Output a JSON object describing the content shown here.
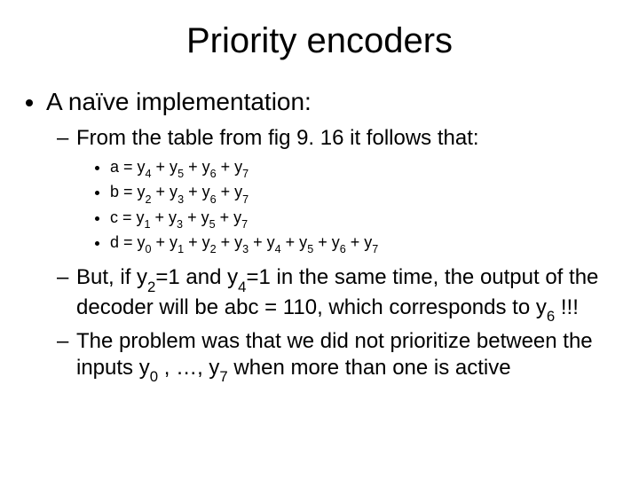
{
  "title": "Priority encoders",
  "l1": "A naïve implementation:",
  "l2a": "From the table from fig 9. 16 it follows that:",
  "eq_a_pre": "a = y",
  "eq_b_pre": "b = y",
  "eq_c_pre": "c =  y",
  "eq_d_pre": "d = y",
  "plus_y": " + y",
  "n0": "0",
  "n1": "1",
  "n2": "2",
  "n3": "3",
  "n4": "4",
  "n5": "5",
  "n6": "6",
  "n7": "7",
  "but1": "But, if y",
  "but2": "=1 and y",
  "but3": "=1 in the same time, the output of the decoder will be abc = 110, which corresponds to y",
  "but4": " !!!",
  "prob1": "The problem was that we did not prioritize between the inputs y",
  "prob2": " , …, y",
  "prob3": " when more than one is active"
}
